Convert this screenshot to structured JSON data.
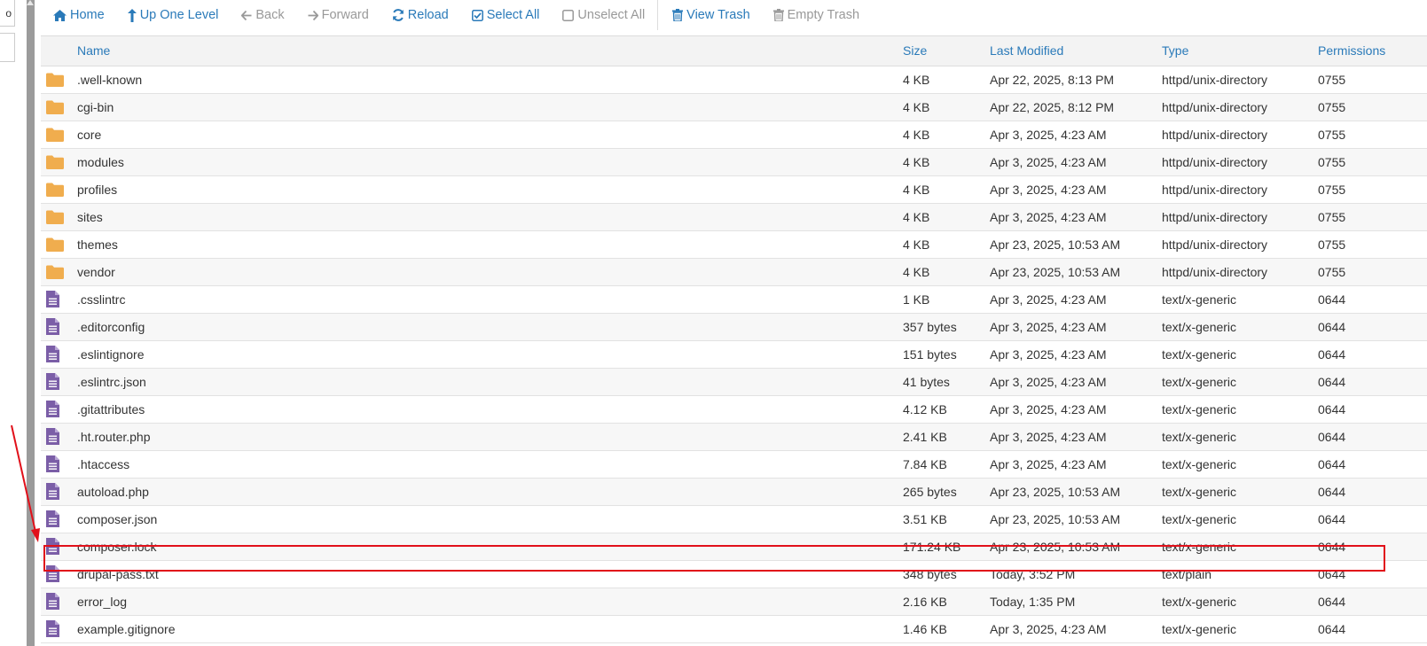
{
  "left_panel": {
    "glyph": "o"
  },
  "toolbar": {
    "home": "Home",
    "up_one_level": "Up One Level",
    "back": "Back",
    "forward": "Forward",
    "reload": "Reload",
    "select_all": "Select All",
    "unselect_all": "Unselect All",
    "view_trash": "View Trash",
    "empty_trash": "Empty Trash"
  },
  "table": {
    "headers": {
      "name": "Name",
      "size": "Size",
      "modified": "Last Modified",
      "type": "Type",
      "permissions": "Permissions"
    },
    "rows": [
      {
        "icon": "folder-icon",
        "name": ".well-known",
        "size": "4 KB",
        "modified": "Apr 22, 2025, 8:13 PM",
        "type": "httpd/unix-directory",
        "perm": "0755"
      },
      {
        "icon": "folder-icon",
        "name": "cgi-bin",
        "size": "4 KB",
        "modified": "Apr 22, 2025, 8:12 PM",
        "type": "httpd/unix-directory",
        "perm": "0755"
      },
      {
        "icon": "folder-icon",
        "name": "core",
        "size": "4 KB",
        "modified": "Apr 3, 2025, 4:23 AM",
        "type": "httpd/unix-directory",
        "perm": "0755"
      },
      {
        "icon": "folder-icon",
        "name": "modules",
        "size": "4 KB",
        "modified": "Apr 3, 2025, 4:23 AM",
        "type": "httpd/unix-directory",
        "perm": "0755"
      },
      {
        "icon": "folder-icon",
        "name": "profiles",
        "size": "4 KB",
        "modified": "Apr 3, 2025, 4:23 AM",
        "type": "httpd/unix-directory",
        "perm": "0755"
      },
      {
        "icon": "folder-icon",
        "name": "sites",
        "size": "4 KB",
        "modified": "Apr 3, 2025, 4:23 AM",
        "type": "httpd/unix-directory",
        "perm": "0755"
      },
      {
        "icon": "folder-icon",
        "name": "themes",
        "size": "4 KB",
        "modified": "Apr 23, 2025, 10:53 AM",
        "type": "httpd/unix-directory",
        "perm": "0755"
      },
      {
        "icon": "folder-icon",
        "name": "vendor",
        "size": "4 KB",
        "modified": "Apr 23, 2025, 10:53 AM",
        "type": "httpd/unix-directory",
        "perm": "0755"
      },
      {
        "icon": "file-icon",
        "name": ".csslintrc",
        "size": "1 KB",
        "modified": "Apr 3, 2025, 4:23 AM",
        "type": "text/x-generic",
        "perm": "0644"
      },
      {
        "icon": "file-icon",
        "name": ".editorconfig",
        "size": "357 bytes",
        "modified": "Apr 3, 2025, 4:23 AM",
        "type": "text/x-generic",
        "perm": "0644"
      },
      {
        "icon": "file-icon",
        "name": ".eslintignore",
        "size": "151 bytes",
        "modified": "Apr 3, 2025, 4:23 AM",
        "type": "text/x-generic",
        "perm": "0644"
      },
      {
        "icon": "file-icon",
        "name": ".eslintrc.json",
        "size": "41 bytes",
        "modified": "Apr 3, 2025, 4:23 AM",
        "type": "text/x-generic",
        "perm": "0644"
      },
      {
        "icon": "file-icon",
        "name": ".gitattributes",
        "size": "4.12 KB",
        "modified": "Apr 3, 2025, 4:23 AM",
        "type": "text/x-generic",
        "perm": "0644"
      },
      {
        "icon": "file-icon",
        "name": ".ht.router.php",
        "size": "2.41 KB",
        "modified": "Apr 3, 2025, 4:23 AM",
        "type": "text/x-generic",
        "perm": "0644"
      },
      {
        "icon": "file-icon",
        "name": ".htaccess",
        "size": "7.84 KB",
        "modified": "Apr 3, 2025, 4:23 AM",
        "type": "text/x-generic",
        "perm": "0644"
      },
      {
        "icon": "file-icon",
        "name": "autoload.php",
        "size": "265 bytes",
        "modified": "Apr 23, 2025, 10:53 AM",
        "type": "text/x-generic",
        "perm": "0644"
      },
      {
        "icon": "file-icon",
        "name": "composer.json",
        "size": "3.51 KB",
        "modified": "Apr 23, 2025, 10:53 AM",
        "type": "text/x-generic",
        "perm": "0644"
      },
      {
        "icon": "file-icon",
        "name": "composer.lock",
        "size": "171.24 KB",
        "modified": "Apr 23, 2025, 10:53 AM",
        "type": "text/x-generic",
        "perm": "0644"
      },
      {
        "icon": "file-icon",
        "name": "drupal-pass.txt",
        "size": "348 bytes",
        "modified": "Today, 3:52 PM",
        "type": "text/plain",
        "perm": "0644"
      },
      {
        "icon": "file-icon",
        "name": "error_log",
        "size": "2.16 KB",
        "modified": "Today, 1:35 PM",
        "type": "text/x-generic",
        "perm": "0644"
      },
      {
        "icon": "file-icon",
        "name": "example.gitignore",
        "size": "1.46 KB",
        "modified": "Apr 3, 2025, 4:23 AM",
        "type": "text/x-generic",
        "perm": "0644"
      }
    ]
  },
  "colors": {
    "link": "#2a7ab9",
    "folder": "#f0ad4e",
    "file": "#7b5ea7",
    "highlight": "#e1101a"
  }
}
